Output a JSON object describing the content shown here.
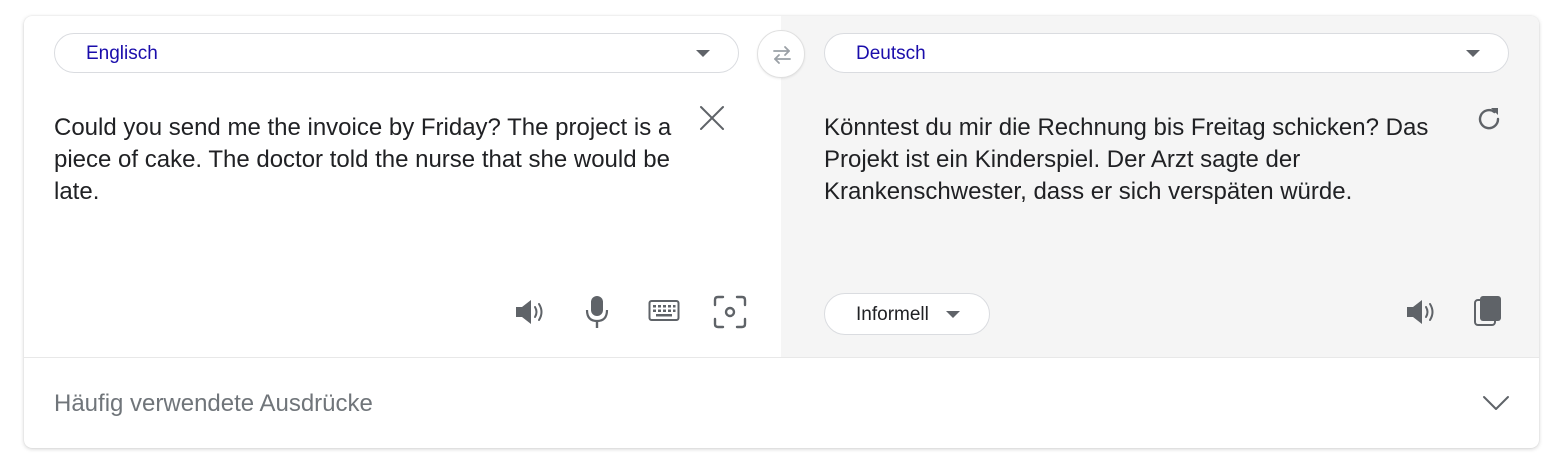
{
  "source": {
    "language": "Englisch",
    "text": "Could you send me the invoice by Friday? The project is a piece of cake. The doctor told the nurse that she would be late."
  },
  "target": {
    "language": "Deutsch",
    "text": "Könntest du mir die Rechnung bis Freitag schicken? Das Projekt ist ein Kinderspiel. Der Arzt sagte der Krankenschwester, dass er sich verspäten würde.",
    "formality": "Informell"
  },
  "phrases": {
    "label": "Häufig verwendete Ausdrücke"
  },
  "icons": {
    "swap": "swap-arrows-icon",
    "clear": "close-icon",
    "refresh": "refresh-icon",
    "source_listen": "speaker-icon",
    "microphone": "microphone-icon",
    "keyboard": "keyboard-icon",
    "camera": "camera-icon",
    "target_listen": "speaker-icon",
    "copy": "copy-icon",
    "expand": "chevron-down-icon"
  },
  "colors": {
    "language_link": "#1a0dab",
    "text": "#202124",
    "icon": "#5f6368",
    "muted": "#70757a",
    "target_background": "#f5f5f5"
  }
}
